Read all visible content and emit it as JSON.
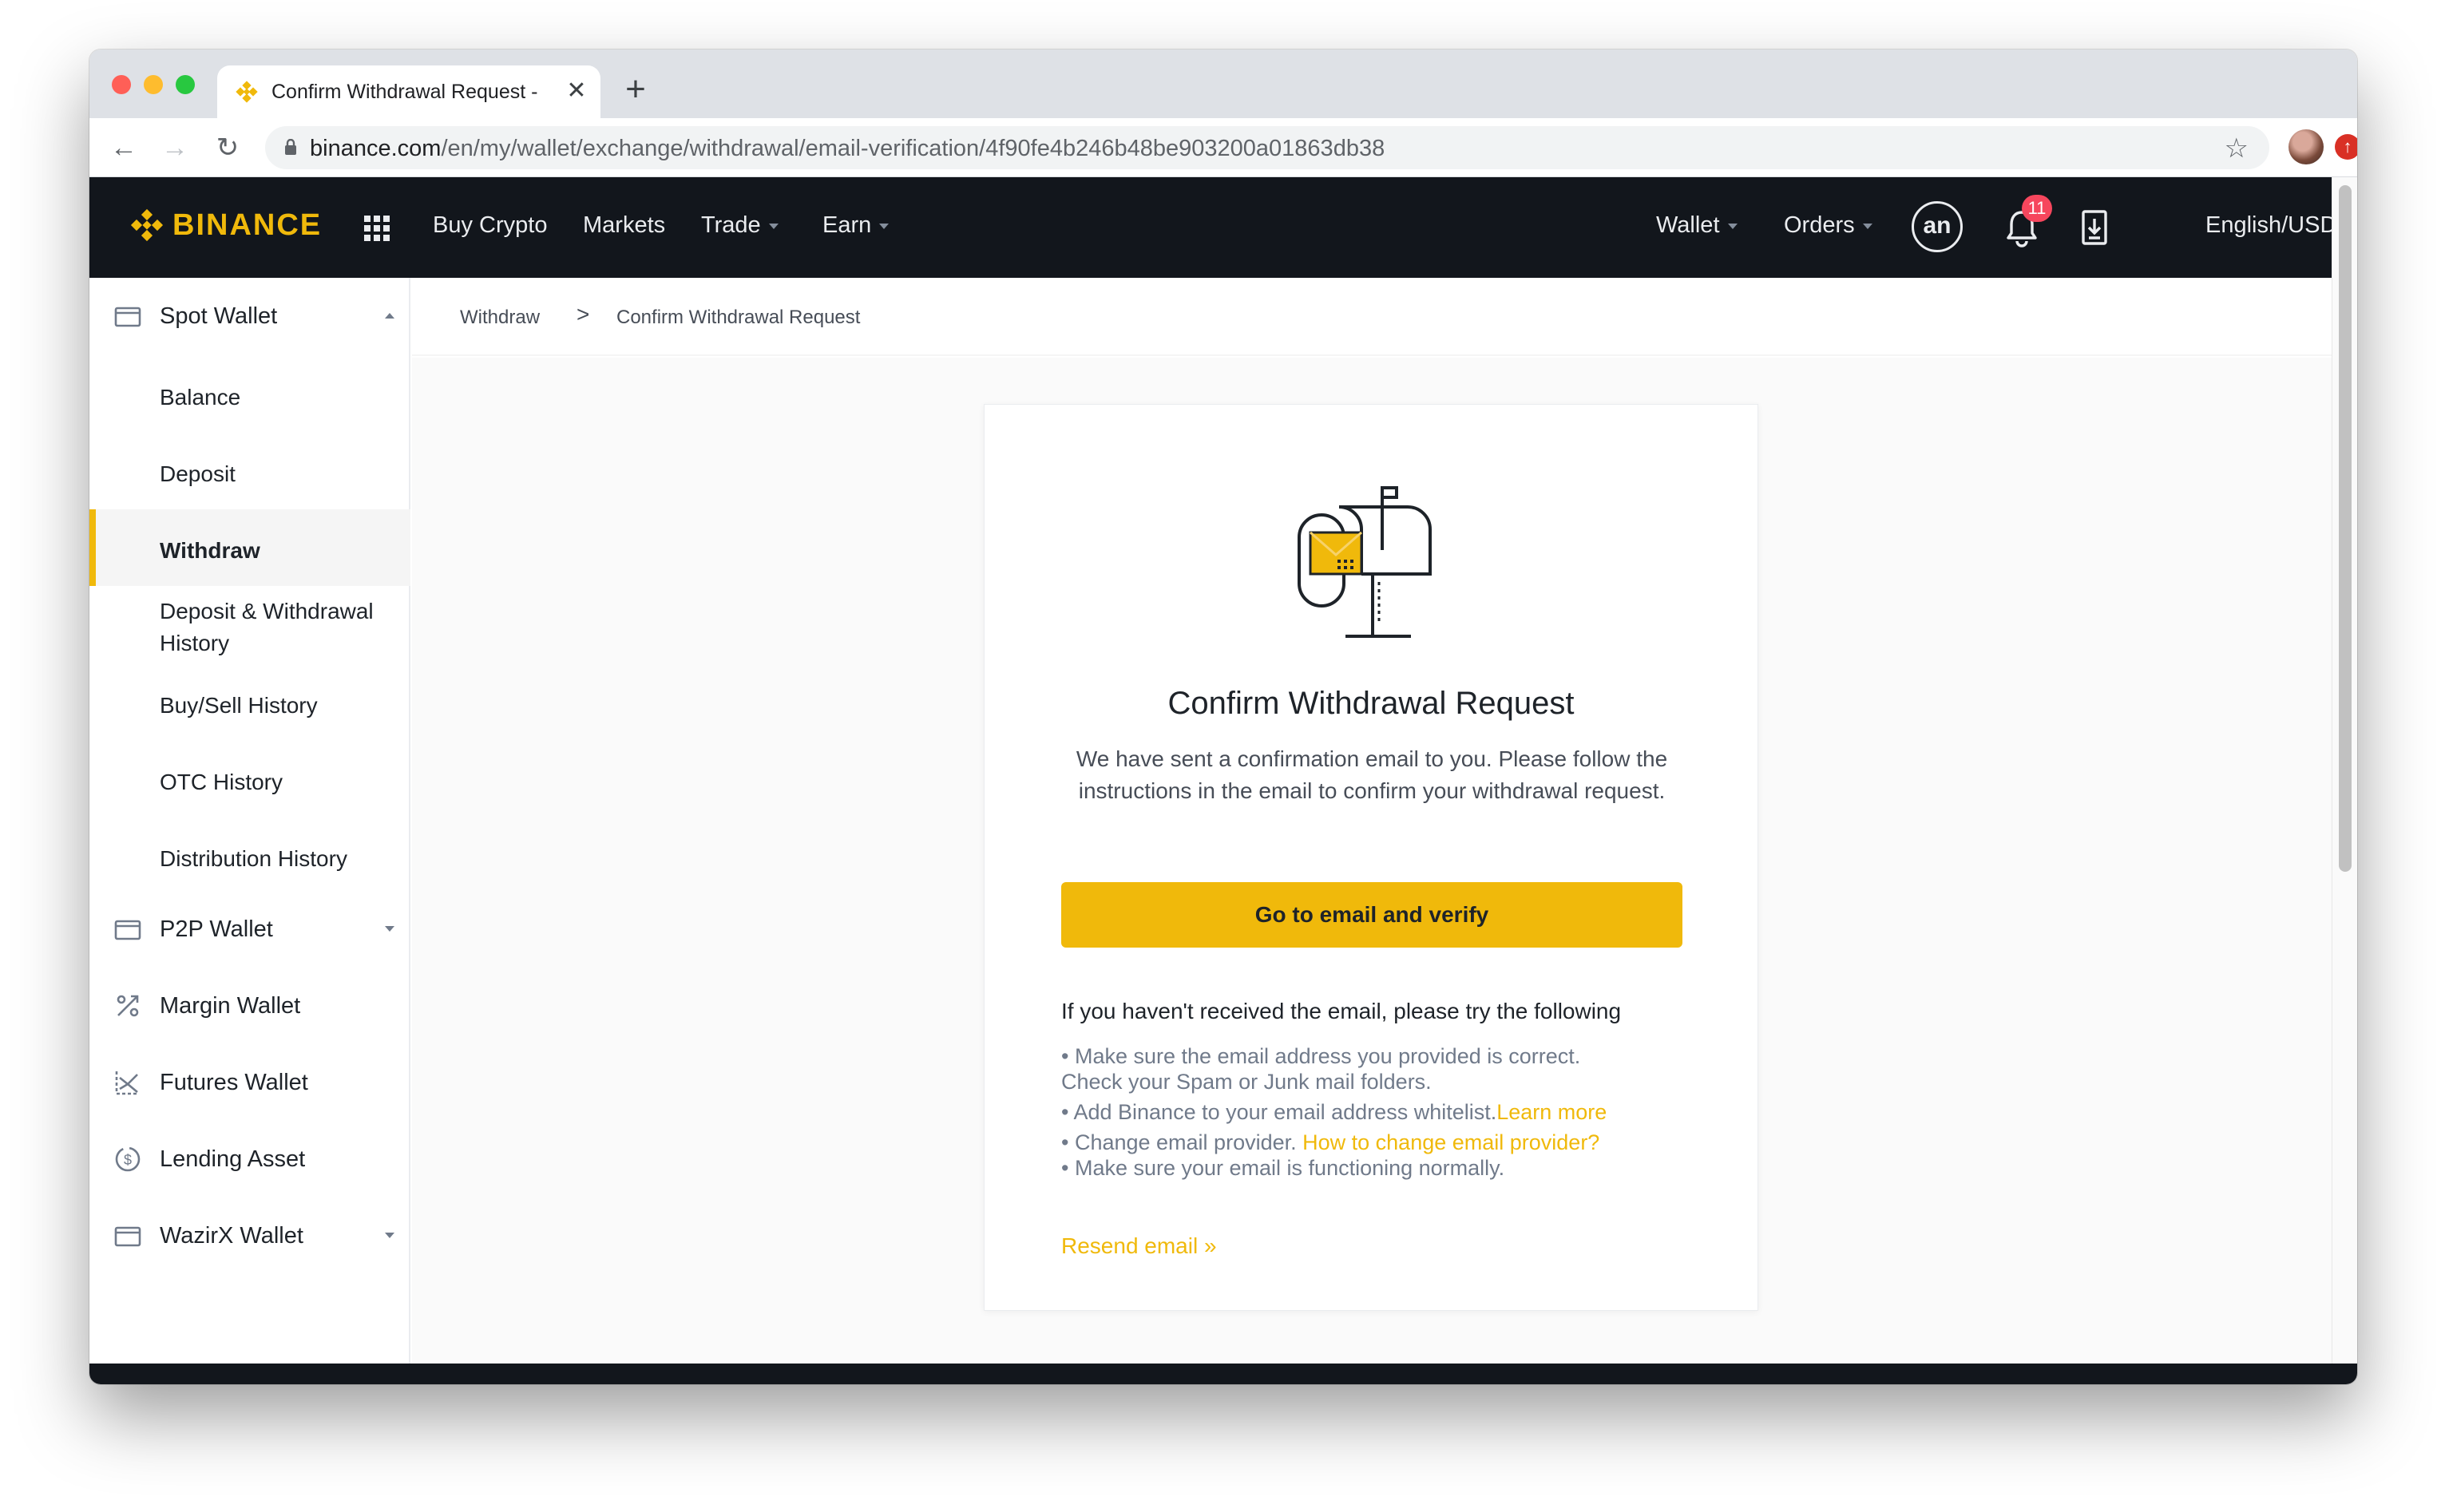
{
  "browser": {
    "tab_title": "Confirm Withdrawal Request -",
    "new_tab_label": "+",
    "url_host": "binance.com",
    "url_path": "/en/my/wallet/exchange/withdrawal/email-verification/4f90fe4b246b48be903200a01863db38"
  },
  "header": {
    "logo_text": "BINANCE",
    "nav": [
      "Buy Crypto",
      "Markets",
      "Trade",
      "Earn"
    ],
    "wallet_label": "Wallet",
    "orders_label": "Orders",
    "user_initials": "an",
    "notifications_count": "11",
    "language_label": "English/USD"
  },
  "sidebar": {
    "spot_wallet": "Spot Wallet",
    "spot_items": [
      "Balance",
      "Deposit",
      "Withdraw",
      "Deposit & Withdrawal",
      "History",
      "Buy/Sell History",
      "OTC History",
      "Distribution History"
    ],
    "p2p_wallet": "P2P Wallet",
    "margin_wallet": "Margin Wallet",
    "futures_wallet": "Futures Wallet",
    "lending_asset": "Lending Asset",
    "wazirx_wallet": "WazirX Wallet"
  },
  "breadcrumb": {
    "first": "Withdraw",
    "separator": ">",
    "current": "Confirm Withdrawal Request"
  },
  "card": {
    "title": "Confirm Withdrawal Request",
    "description": "We have sent a confirmation email to you. Please follow the instructions in the email to confirm your withdrawal request.",
    "button_label": "Go to email and verify",
    "help_title": "If you haven't received the email, please try the following",
    "tip1_line1": "• Make sure the email address you provided is correct.",
    "tip1_line2": "Check your Spam or Junk mail folders.",
    "tip2_text": "• Add Binance to your email address whitelist.",
    "tip2_link": "Learn more",
    "tip3_text": "• Change email provider. ",
    "tip3_link": "How to change email provider?",
    "tip4_text": "• Make sure your email is functioning normally.",
    "resend_label": "Resend email »"
  },
  "colors": {
    "brand_yellow": "#f0b90b",
    "header_bg": "#12161c",
    "badge_red": "#f6465d"
  },
  "icons": [
    "lock-icon",
    "star-icon",
    "grid-apps-icon",
    "bell-icon",
    "download-app-icon",
    "wallet-icon",
    "margin-percent-icon",
    "futures-chart-icon",
    "lending-dollar-icon",
    "mailbox-illustration"
  ]
}
